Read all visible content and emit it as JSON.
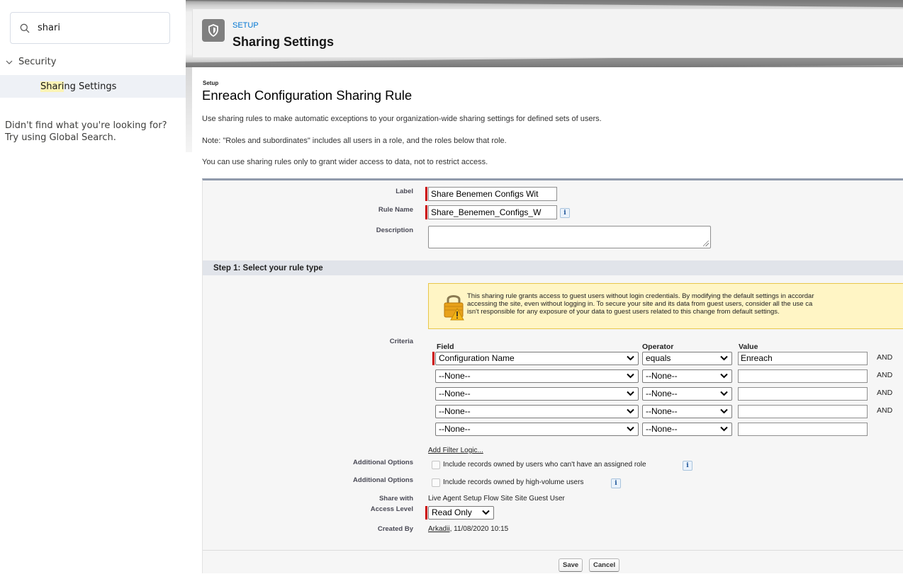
{
  "sidebar": {
    "search_value": "shari",
    "tree_parent": "Security",
    "tree_item_highlight": "Shari",
    "tree_item_rest": "ng Settings",
    "not_found_line1": "Didn't find what you're looking for?",
    "not_found_line2": "Try using Global Search."
  },
  "banner": {
    "setup_label": "SETUP",
    "title": "Sharing Settings"
  },
  "page": {
    "crumb": "Setup",
    "heading": "Enreach Configuration Sharing Rule",
    "intro": [
      "Use sharing rules to make automatic exceptions to your organization-wide sharing settings for defined sets of users.",
      "Note: \"Roles and subordinates\" includes all users in a role, and the roles below that role.",
      "You can use sharing rules only to grant wider access to data, not to restrict access."
    ]
  },
  "form": {
    "label_label": "Label",
    "label_value": "Share Benemen Configs Wit",
    "rule_name_label": "Rule Name",
    "rule_name_value": "Share_Benemen_Configs_W",
    "info_glyph": "i",
    "description_label": "Description",
    "description_value": "",
    "step1_title": "Step 1: Select your rule type",
    "warning": [
      "This sharing rule grants access to guest users without login credentials. By modifying the default settings in accordar",
      "accessing the site, even without logging in. To secure your site and its data from guest users, consider all the use ca",
      "isn't responsible for any exposure of your data to guest users related to this change from default settings."
    ],
    "criteria_label": "Criteria",
    "col_field": "Field",
    "col_operator": "Operator",
    "col_value": "Value",
    "criteria_rows": [
      {
        "field": "Configuration Name",
        "operator": "equals",
        "value": "Enreach",
        "join": "AND"
      },
      {
        "field": "--None--",
        "operator": "--None--",
        "value": "",
        "join": "AND"
      },
      {
        "field": "--None--",
        "operator": "--None--",
        "value": "",
        "join": "AND"
      },
      {
        "field": "--None--",
        "operator": "--None--",
        "value": "",
        "join": "AND"
      },
      {
        "field": "--None--",
        "operator": "--None--",
        "value": "",
        "join": ""
      }
    ],
    "add_filter_logic": "Add Filter Logic...",
    "additional_options_label": "Additional Options",
    "option1": "Include records owned by users who can't have an assigned role",
    "option2": "Include records owned by high-volume users",
    "share_with_label": "Share with",
    "share_with_value": "Live Agent Setup Flow Site Site Guest User",
    "access_level_label": "Access Level",
    "access_level_value": "Read Only",
    "created_by_label": "Created By",
    "created_by_user": "Arkadii",
    "created_by_date": ", 11/08/2020 10:15",
    "save_label": "Save",
    "cancel_label": "Cancel"
  },
  "colors": {
    "required": "#cc0000",
    "link": "#0176d3",
    "highlight": "#fbf3b4",
    "warning_bg": "#fff5c5"
  }
}
